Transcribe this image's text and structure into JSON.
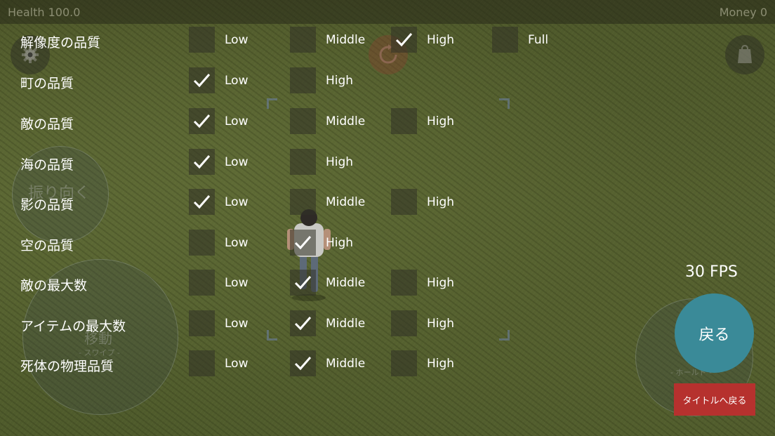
{
  "hud": {
    "health_text": "Health 100.0",
    "money_text": "Money 0",
    "fps_text": "30 FPS"
  },
  "controls": {
    "look_label": "振り向く",
    "move_label": "移動",
    "swipe_label": "- スワイプ -",
    "hold_label": "- ホールド -"
  },
  "buttons": {
    "back_label": "戻る",
    "title_label": "タイトルへ戻る"
  },
  "colors": {
    "back_button": "#3a8a98",
    "title_button": "#b6312e"
  },
  "settings": {
    "resolution": {
      "label": "解像度の品質",
      "options": [
        {
          "label": "Low",
          "checked": false
        },
        {
          "label": "Middle",
          "checked": false
        },
        {
          "label": "High",
          "checked": true
        },
        {
          "label": "Full",
          "checked": false
        }
      ]
    },
    "town": {
      "label": "町の品質",
      "options": [
        {
          "label": "Low",
          "checked": true
        },
        {
          "label": "High",
          "checked": false
        }
      ]
    },
    "enemy": {
      "label": "敵の品質",
      "options": [
        {
          "label": "Low",
          "checked": true
        },
        {
          "label": "Middle",
          "checked": false
        },
        {
          "label": "High",
          "checked": false
        }
      ]
    },
    "sea": {
      "label": "海の品質",
      "options": [
        {
          "label": "Low",
          "checked": true
        },
        {
          "label": "High",
          "checked": false
        }
      ]
    },
    "shadow": {
      "label": "影の品質",
      "options": [
        {
          "label": "Low",
          "checked": true
        },
        {
          "label": "Middle",
          "checked": false
        },
        {
          "label": "High",
          "checked": false
        }
      ]
    },
    "sky": {
      "label": "空の品質",
      "options": [
        {
          "label": "Low",
          "checked": false
        },
        {
          "label": "High",
          "checked": true
        }
      ]
    },
    "max_enemies": {
      "label": "敵の最大数",
      "options": [
        {
          "label": "Low",
          "checked": false
        },
        {
          "label": "Middle",
          "checked": true
        },
        {
          "label": "High",
          "checked": false
        }
      ]
    },
    "max_items": {
      "label": "アイテムの最大数",
      "options": [
        {
          "label": "Low",
          "checked": false
        },
        {
          "label": "Middle",
          "checked": true
        },
        {
          "label": "High",
          "checked": false
        }
      ]
    },
    "corpse_physics": {
      "label": "死体の物理品質",
      "options": [
        {
          "label": "Low",
          "checked": false
        },
        {
          "label": "Middle",
          "checked": true
        },
        {
          "label": "High",
          "checked": false
        }
      ]
    }
  }
}
